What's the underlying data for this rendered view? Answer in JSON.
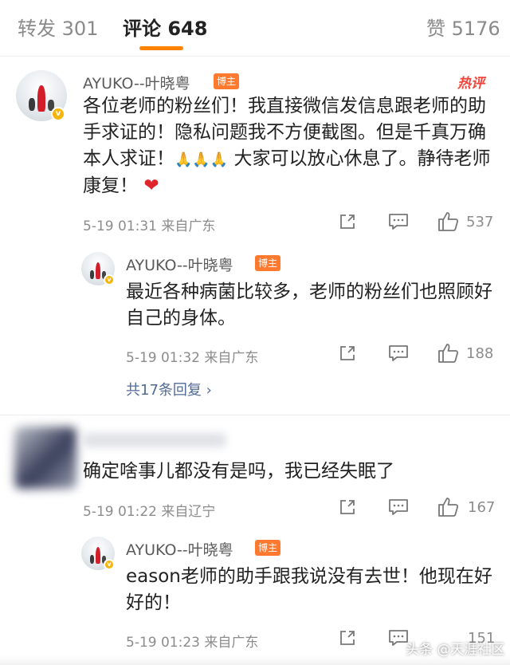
{
  "tabs": {
    "repost": "转发 301",
    "comments": "评论 648",
    "likes": "赞 5176"
  },
  "hot_label": "热评",
  "comments": [
    {
      "username": "AYUKO--叶晓粤",
      "tag": "博主",
      "text_a": "各位老师的粉丝们！我直接微信发信息跟老师的助手求证的！隐私问题我不方便截图。但是千真万确本人求证！",
      "emoji_clap": "🙏🙏🙏",
      "text_b": " 大家可以放心休息了。静待老师康复！",
      "emoji_heart": "❤",
      "meta": "5-19 01:31  来自广东",
      "likes": "537",
      "reply": {
        "username": "AYUKO--叶晓粤",
        "tag": "博主",
        "text": "最近各种病菌比较多，老师的粉丝们也照顾好自己的身体。",
        "meta": "5-19 01:32  来自广东",
        "likes": "188"
      },
      "more_replies": "共17条回复 ›"
    },
    {
      "username": "",
      "text": "确定啥事儿都没有是吗，我已经失眠了",
      "meta": "5-19 01:22  来自辽宁",
      "likes": "167",
      "reply": {
        "username": "AYUKO--叶晓粤",
        "tag": "博主",
        "text": "eason老师的助手跟我说没有去世！他现在好好的！",
        "meta": "5-19 01:23  来自广东",
        "likes": "151"
      }
    }
  ],
  "watermark": "头条 @天涯社区",
  "colors": {
    "accent": "#ff8200",
    "tag": "#ff7a2e",
    "hot": "#f0463c",
    "link": "#506b96",
    "verified": "#f5b50a"
  },
  "icons": {
    "share": "share-icon",
    "comment": "comment-icon",
    "like": "thumbs-up-icon"
  }
}
